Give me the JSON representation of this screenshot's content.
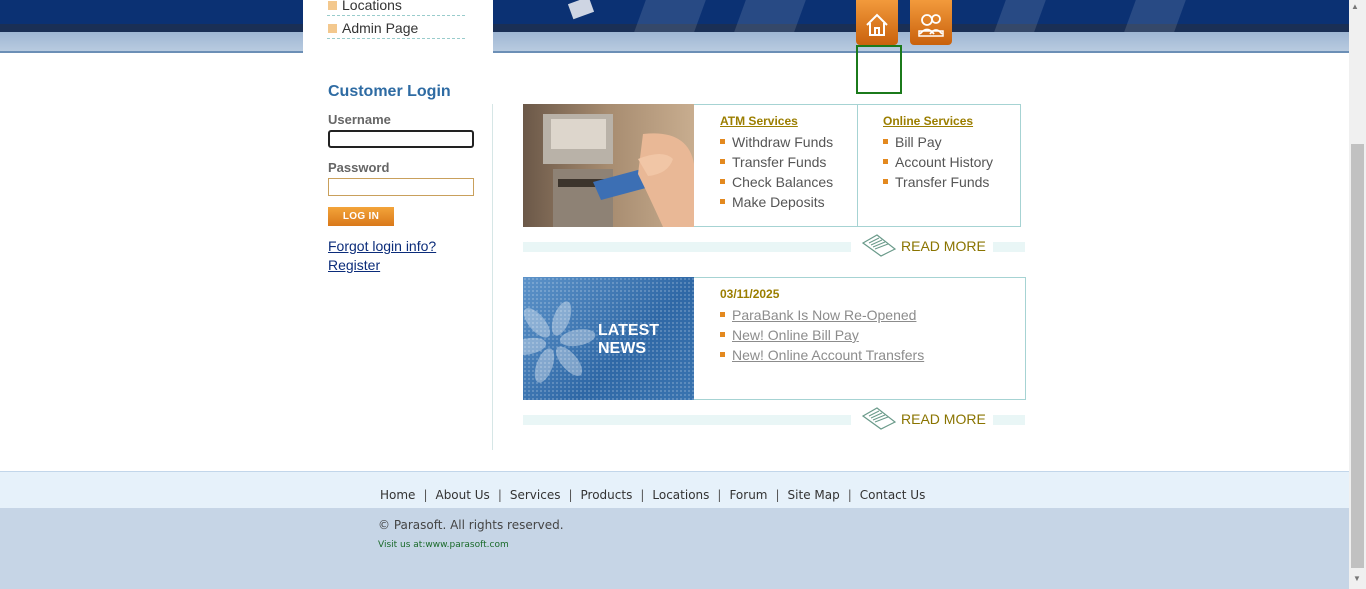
{
  "sidebar": {
    "items": [
      {
        "label": "Locations"
      },
      {
        "label": "Admin Page"
      }
    ]
  },
  "login": {
    "title": "Customer Login",
    "username_label": "Username",
    "password_label": "Password",
    "username_value": "",
    "password_value": "",
    "button_label": "LOG IN",
    "forgot_link": "Forgot login info?",
    "register_link": "Register"
  },
  "top_icons": [
    "home-icon",
    "contact-icon"
  ],
  "services": {
    "atm": {
      "title": "ATM Services",
      "items": [
        "Withdraw Funds",
        "Transfer Funds",
        "Check Balances",
        "Make Deposits"
      ]
    },
    "online": {
      "title": "Online Services",
      "items": [
        "Bill Pay",
        "Account History",
        "Transfer Funds"
      ]
    },
    "read_more": "READ MORE"
  },
  "news": {
    "image_title_line1": "LATEST",
    "image_title_line2": "NEWS",
    "date": "03/11/2025",
    "items": [
      "ParaBank Is Now Re-Opened",
      "New! Online Bill Pay",
      "New! Online Account Transfers"
    ],
    "read_more": "READ MORE"
  },
  "footer": {
    "links": [
      "Home",
      "About Us",
      "Services",
      "Products",
      "Locations",
      "Forum",
      "Site Map",
      "Contact Us"
    ],
    "separator": "|",
    "copyright": "© Parasoft. All rights reserved.",
    "visit": "Visit us at:www.parasoft.com"
  },
  "colors": {
    "header_dark": "#0b3173",
    "accent_orange": "#e3891f",
    "title_blue": "#2e6ba3",
    "gold_text": "#9b7e00"
  }
}
